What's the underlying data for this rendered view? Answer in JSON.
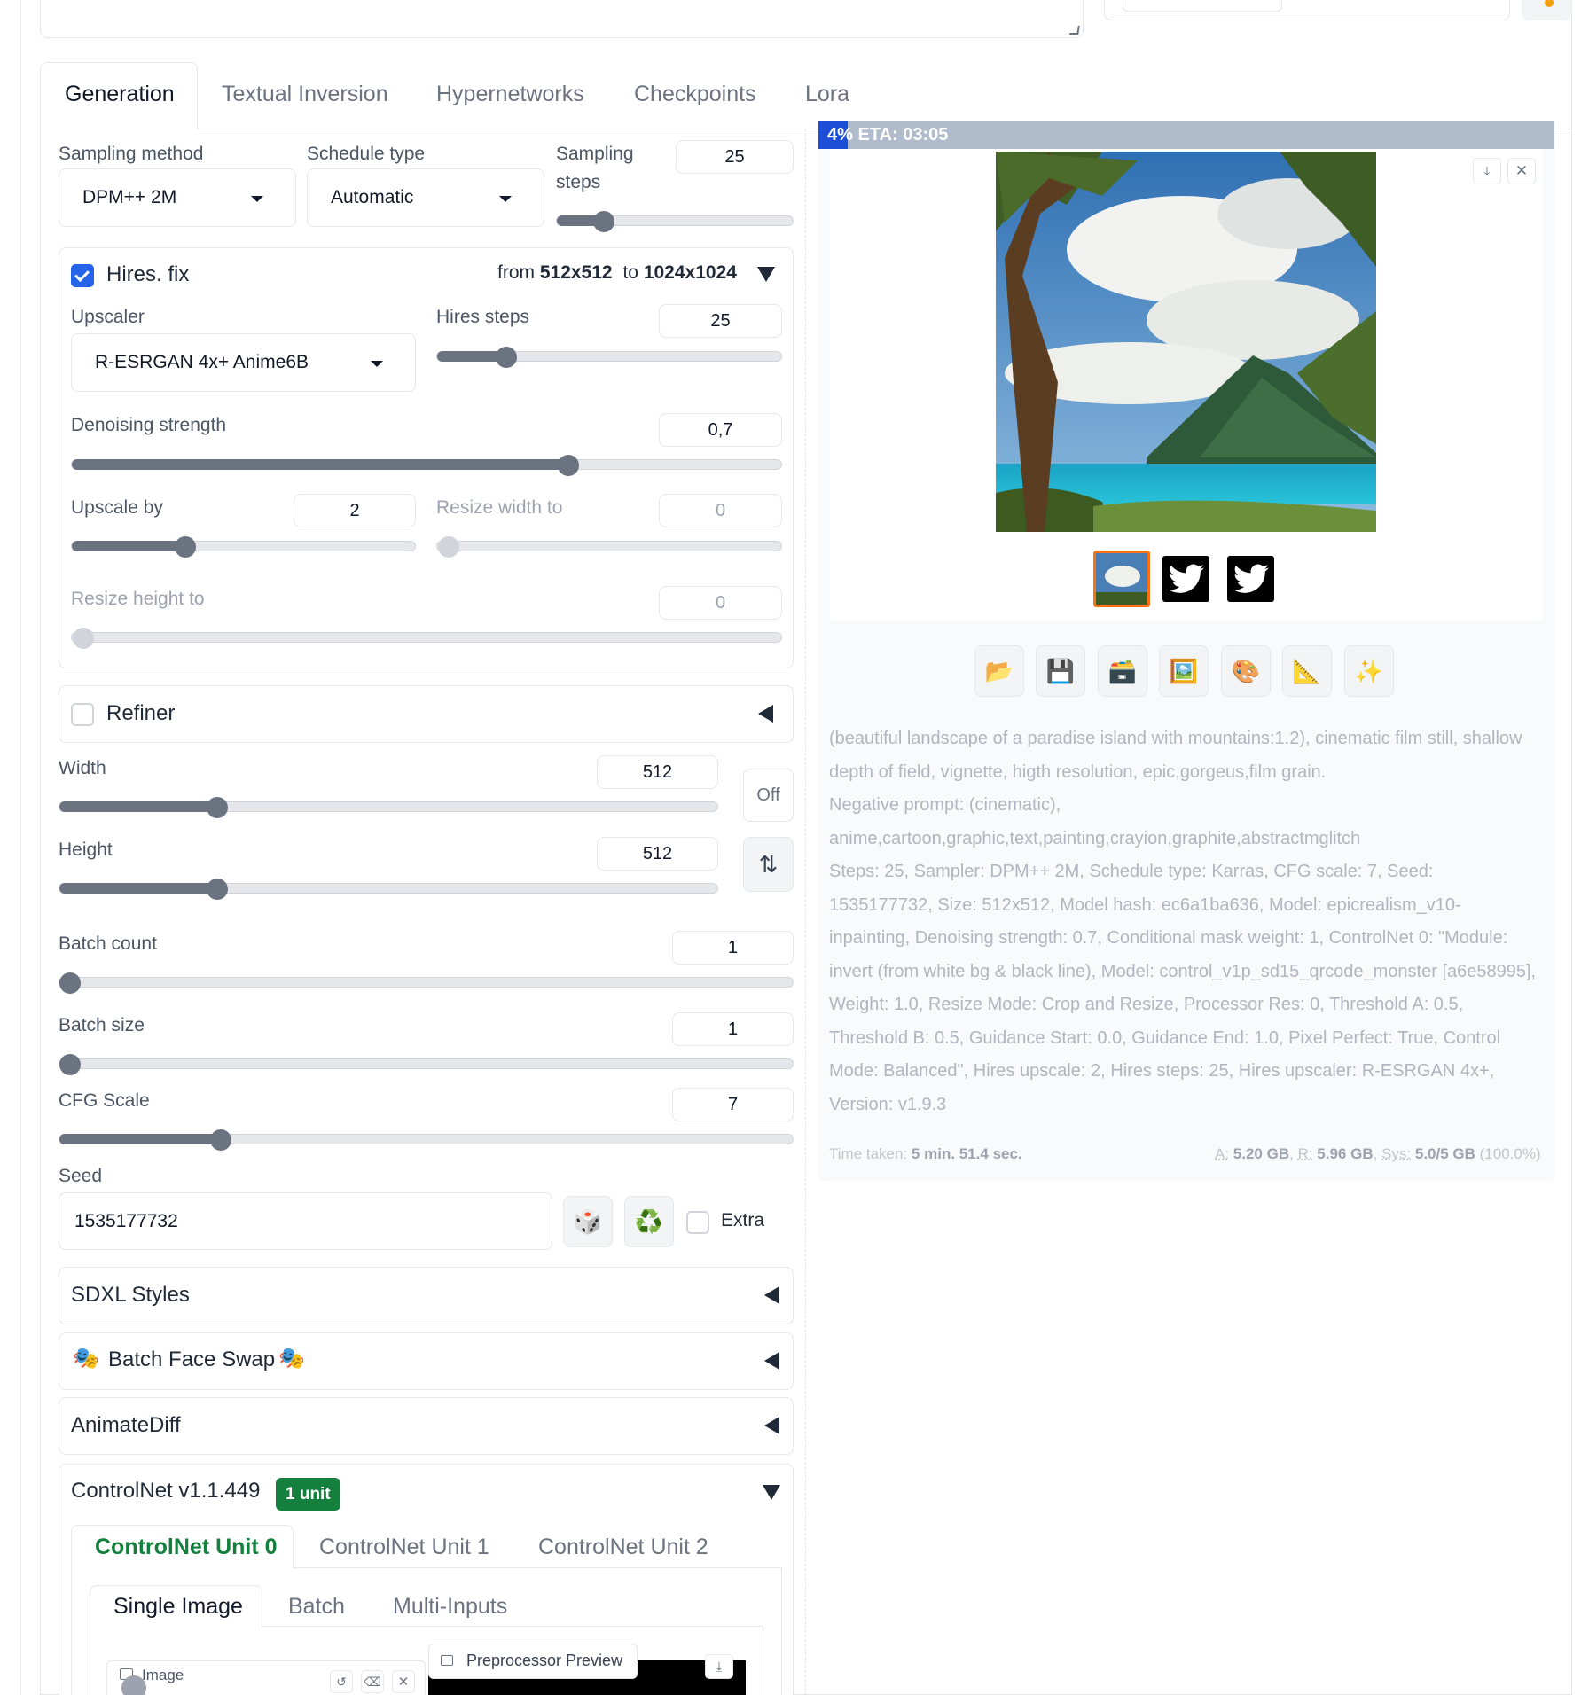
{
  "tabs": [
    "Generation",
    "Textual Inversion",
    "Hypernetworks",
    "Checkpoints",
    "Lora"
  ],
  "sampling": {
    "method_label": "Sampling method",
    "method_value": "DPM++ 2M",
    "schedule_label": "Schedule type",
    "schedule_value": "Automatic",
    "steps_label_1": "Sampling",
    "steps_label_2": "steps",
    "steps_value": "25",
    "steps_level": 0.2
  },
  "hires": {
    "checkbox_label": "Hires. fix",
    "from_text": "from",
    "from_value": "512x512",
    "to_text": "to",
    "to_value": "1024x1024",
    "upscaler_label": "Upscaler",
    "upscaler_value": "R-ESRGAN 4x+ Anime6B",
    "steps_label": "Hires steps",
    "steps_value": "25",
    "steps_level": 0.2,
    "denoise_label": "Denoising strength",
    "denoise_value": "0,7",
    "denoise_level": 0.7,
    "upscale_label": "Upscale by",
    "upscale_value": "2",
    "upscale_level": 0.33,
    "resize_w_label": "Resize width to",
    "resize_w_value": "0",
    "resize_h_label": "Resize height to",
    "resize_h_value": "0"
  },
  "refiner": {
    "label": "Refiner"
  },
  "dims": {
    "width_label": "Width",
    "width_value": "512",
    "width_level": 0.24,
    "height_label": "Height",
    "height_value": "512",
    "height_level": 0.24,
    "off_label": "Off",
    "swap_icon": "⇅"
  },
  "batch": {
    "count_label": "Batch count",
    "count_value": "1",
    "count_level": 0,
    "size_label": "Batch size",
    "size_value": "1",
    "size_level": 0,
    "cfg_label": "CFG Scale",
    "cfg_value": "7",
    "cfg_level": 0.22
  },
  "seed": {
    "label": "Seed",
    "value": "1535177732",
    "dice": "🎲",
    "recycle": "♻️",
    "extra_label": "Extra"
  },
  "accordions": {
    "sdxl": "SDXL Styles",
    "faceswap": "Batch Face Swap",
    "faceswap_icon": "🎭",
    "animatediff": "AnimateDiff",
    "controlnet": "ControlNet v1.1.449",
    "controlnet_badge": "1 unit"
  },
  "controlnet_units": [
    "ControlNet Unit 0",
    "ControlNet Unit 1",
    "ControlNet Unit 2"
  ],
  "controlnet_modes": [
    "Single Image",
    "Batch",
    "Multi-Inputs"
  ],
  "controlnet_image": {
    "image_label": "Image",
    "preview_label": "Preprocessor Preview"
  },
  "progress": {
    "text": "4% ETA: 03:05",
    "level": 0.04
  },
  "action_buttons": [
    "📂",
    "💾",
    "🗃️",
    "🖼️",
    "🎨",
    "📐",
    "✨"
  ],
  "info": {
    "prompt": "(beautiful landscape of a paradise island with mountains:1.2), cinematic film still, shallow depth of field, vignette, higth resolution, epic,gorgeus,film grain.",
    "negative": "Negative prompt: (cinematic), anime,cartoon,graphic,text,painting,crayion,graphite,abstractmglitch",
    "params": "Steps: 25, Sampler: DPM++ 2M, Schedule type: Karras, CFG scale: 7, Seed: 1535177732, Size: 512x512, Model hash: ec6a1ba636, Model: epicrealism_v10-inpainting, Denoising strength: 0.7, Conditional mask weight: 1, ControlNet 0: \"Module: invert (from white bg & black line), Model: control_v1p_sd15_qrcode_monster [a6e58995], Weight: 1.0, Resize Mode: Crop and Resize, Processor Res: 0, Threshold A: 0.5, Threshold B: 0.5, Guidance Start: 0.0, Guidance End: 1.0, Pixel Perfect: True, Control Mode: Balanced\", Hires upscale: 2, Hires steps: 25, Hires upscaler: R-ESRGAN 4x+, Version: v1.9.3",
    "time_label": "Time taken:",
    "time_value": "5 min. 51.4 sec.",
    "a_label": "A:",
    "a_value": "5.20 GB",
    "r_label": "R:",
    "r_value": "5.96 GB",
    "sys_label": "Sys:",
    "sys_value": "5.0/5 GB",
    "sys_pct": "(100.0%)"
  },
  "colors": {
    "accent_blue": "#2563eb",
    "controlnet_green": "#15803d",
    "selected_thumb": "#f97316"
  }
}
